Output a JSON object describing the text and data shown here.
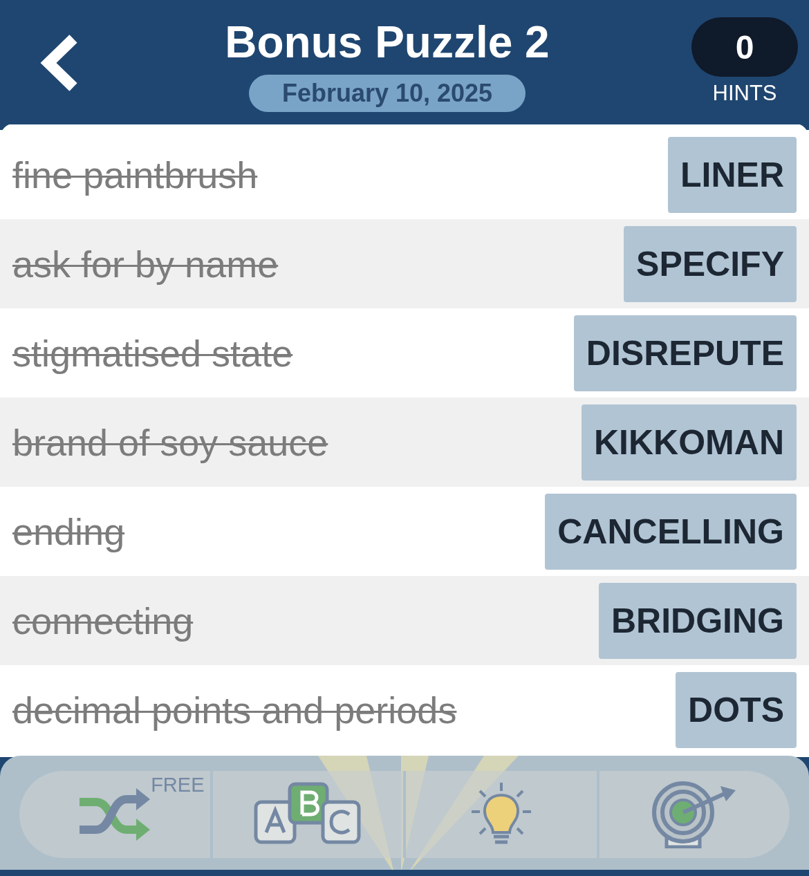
{
  "header": {
    "title": "Bonus Puzzle 2",
    "date": "February 10, 2025",
    "hints": {
      "count": "0",
      "label": "HINTS"
    }
  },
  "clues": [
    {
      "clue": "fine paintbrush",
      "answer": "LINER",
      "solved": true
    },
    {
      "clue": "ask for by name",
      "answer": "SPECIFY",
      "solved": true
    },
    {
      "clue": "stigmatised state",
      "answer": "DISREPUTE",
      "solved": true
    },
    {
      "clue": "brand of soy sauce",
      "answer": "KIKKOMAN",
      "solved": true
    },
    {
      "clue": "ending",
      "answer": "CANCELLING",
      "solved": true
    },
    {
      "clue": "connecting",
      "answer": "BRIDGING",
      "solved": true
    },
    {
      "clue": "decimal points and periods",
      "answer": "DOTS",
      "solved": true
    }
  ],
  "toolbar": [
    {
      "kind": "shuffle",
      "badge": "FREE"
    },
    {
      "kind": "letters"
    },
    {
      "kind": "hint"
    },
    {
      "kind": "target"
    }
  ]
}
